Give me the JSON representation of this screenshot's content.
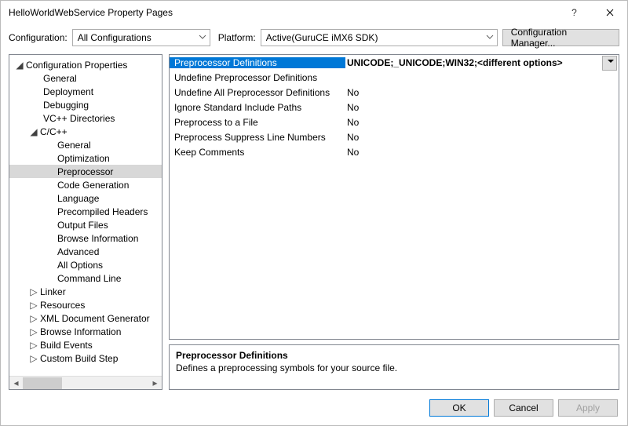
{
  "window": {
    "title": "HelloWorldWebService Property Pages"
  },
  "toolbar": {
    "configuration_label": "Configuration:",
    "configuration_value": "All Configurations",
    "platform_label": "Platform:",
    "platform_value": "Active(GuruCE iMX6 SDK)",
    "configuration_manager": "Configuration Manager..."
  },
  "tree": {
    "root": "Configuration Properties",
    "items": [
      "General",
      "Deployment",
      "Debugging",
      "VC++ Directories"
    ],
    "cc": {
      "label": "C/C++",
      "items": [
        "General",
        "Optimization",
        "Preprocessor",
        "Code Generation",
        "Language",
        "Precompiled Headers",
        "Output Files",
        "Browse Information",
        "Advanced",
        "All Options",
        "Command Line"
      ],
      "selected": "Preprocessor"
    },
    "rest": [
      "Linker",
      "Resources",
      "XML Document Generator",
      "Browse Information",
      "Build Events",
      "Custom Build Step"
    ]
  },
  "grid": {
    "rows": [
      {
        "prop": "Preprocessor Definitions",
        "val": "UNICODE;_UNICODE;WIN32;<different options>",
        "selected": true
      },
      {
        "prop": "Undefine Preprocessor Definitions",
        "val": ""
      },
      {
        "prop": "Undefine All Preprocessor Definitions",
        "val": "No"
      },
      {
        "prop": "Ignore Standard Include Paths",
        "val": "No"
      },
      {
        "prop": "Preprocess to a File",
        "val": "No"
      },
      {
        "prop": "Preprocess Suppress Line Numbers",
        "val": "No"
      },
      {
        "prop": "Keep Comments",
        "val": "No"
      }
    ]
  },
  "description": {
    "heading": "Preprocessor Definitions",
    "text": "Defines a preprocessing symbols for your source file."
  },
  "buttons": {
    "ok": "OK",
    "cancel": "Cancel",
    "apply": "Apply"
  }
}
